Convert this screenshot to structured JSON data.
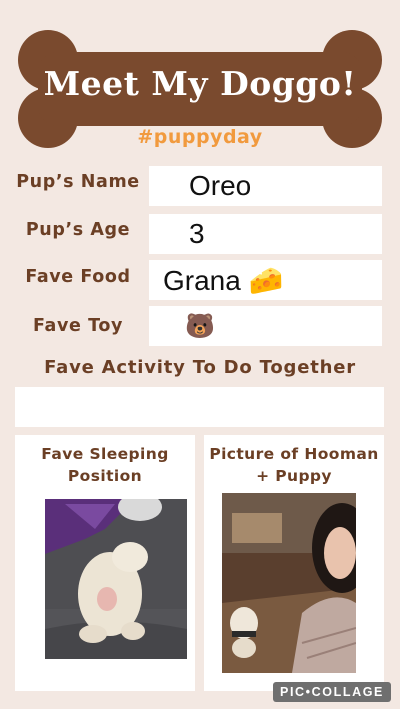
{
  "header": {
    "title": "Meet My Doggo!",
    "hashtag": "#puppyday"
  },
  "fields": [
    {
      "label": "Pup’s Name",
      "value": "Oreo"
    },
    {
      "label": "Pup’s Age",
      "value": "3"
    },
    {
      "label": "Fave Food",
      "value": "Grana 🧀"
    },
    {
      "label": "Fave Toy",
      "value": "🐻"
    }
  ],
  "activity": {
    "label": "Fave Activity To Do Together",
    "value": ""
  },
  "cards": {
    "sleeping": {
      "title": "Fave Sleeping Position"
    },
    "hooman": {
      "title": "Picture of Hooman + Puppy"
    }
  },
  "watermark": "PIC•COLLAGE",
  "colors": {
    "background": "#f3e8e2",
    "bone": "#7a4a2e",
    "heading": "#6b3f25",
    "hashtag": "#f19a3e"
  }
}
